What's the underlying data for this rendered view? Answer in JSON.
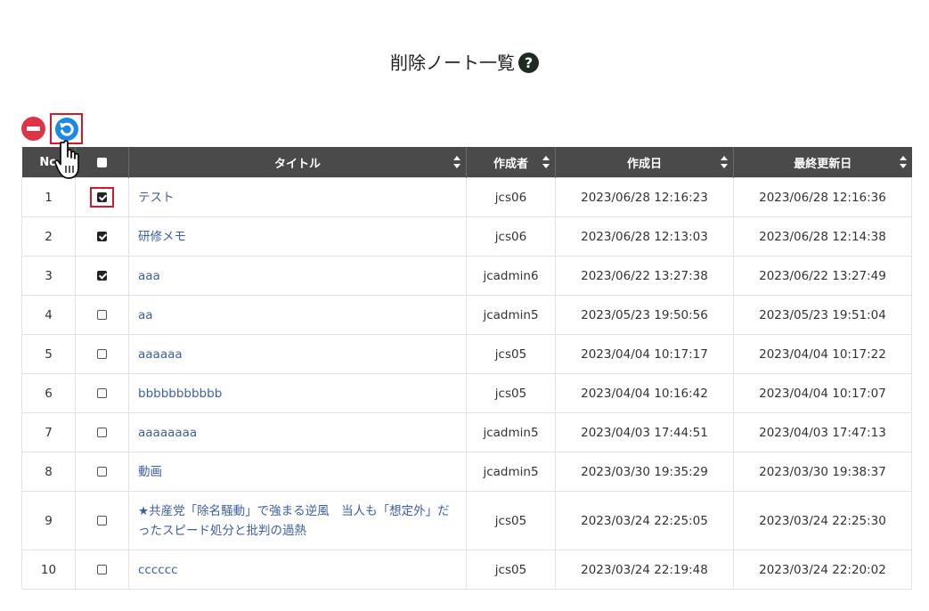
{
  "page": {
    "title": "削除ノート一覧",
    "help_icon": "question-circle-icon"
  },
  "toolbar": {
    "delete_icon": "minus-circle-icon",
    "restore_icon": "undo-circle-icon"
  },
  "table": {
    "columns": {
      "no": "No",
      "title": "タイトル",
      "author": "作成者",
      "created": "作成日",
      "updated": "最終更新日"
    },
    "rows": [
      {
        "no": "1",
        "checked": true,
        "title": "テスト",
        "author": "jcs06",
        "created": "2023/06/28 12:16:23",
        "updated": "2023/06/28 12:16:36"
      },
      {
        "no": "2",
        "checked": true,
        "title": "研修メモ",
        "author": "jcs06",
        "created": "2023/06/28 12:13:03",
        "updated": "2023/06/28 12:14:38"
      },
      {
        "no": "3",
        "checked": true,
        "title": "aaa",
        "author": "jcadmin6",
        "created": "2023/06/22 13:27:38",
        "updated": "2023/06/22 13:27:49"
      },
      {
        "no": "4",
        "checked": false,
        "title": "aa",
        "author": "jcadmin5",
        "created": "2023/05/23 19:50:56",
        "updated": "2023/05/23 19:51:04"
      },
      {
        "no": "5",
        "checked": false,
        "title": "aaaaaa",
        "author": "jcs05",
        "created": "2023/04/04 10:17:17",
        "updated": "2023/04/04 10:17:22"
      },
      {
        "no": "6",
        "checked": false,
        "title": "bbbbbbbbbbb",
        "author": "jcs05",
        "created": "2023/04/04 10:16:42",
        "updated": "2023/04/04 10:17:07"
      },
      {
        "no": "7",
        "checked": false,
        "title": "aaaaaaaa",
        "author": "jcadmin5",
        "created": "2023/04/03 17:44:51",
        "updated": "2023/04/03 17:47:13"
      },
      {
        "no": "8",
        "checked": false,
        "title": "動画",
        "author": "jcadmin5",
        "created": "2023/03/30 19:35:29",
        "updated": "2023/03/30 19:38:37"
      },
      {
        "no": "9",
        "checked": false,
        "title": "★共産党「除名騒動」で強まる逆風　当人も「想定外」だったスピード処分と批判の過熱",
        "author": "jcs05",
        "created": "2023/03/24 22:25:05",
        "updated": "2023/03/24 22:25:30"
      },
      {
        "no": "10",
        "checked": false,
        "title": "cccccc",
        "author": "jcs05",
        "created": "2023/03/24 22:19:48",
        "updated": "2023/03/24 22:20:02"
      }
    ]
  },
  "colors": {
    "header_bg": "#4a4a4a",
    "link": "#3d5fa3",
    "delete": "#dc3545",
    "restore": "#1e88e5",
    "highlight": "#d0192a"
  }
}
